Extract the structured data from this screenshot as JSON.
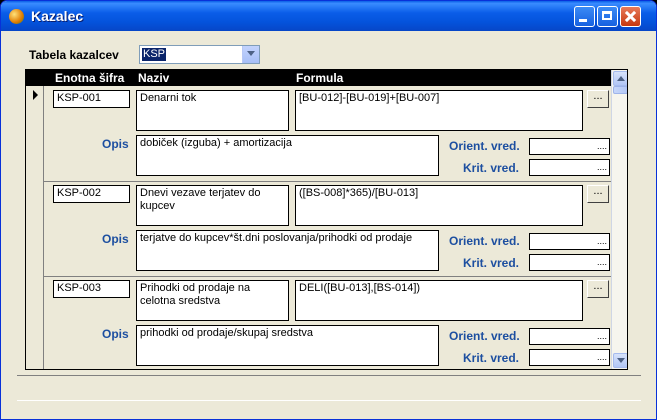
{
  "window": {
    "title": "Kazalec"
  },
  "filter": {
    "label": "Tabela kazalcev",
    "value": "KSP"
  },
  "columns": {
    "code": "Enotna šifra",
    "name": "Naziv",
    "formula": "Formula"
  },
  "labels": {
    "opis": "Opis",
    "orient": "Orient. vred.",
    "krit": "Krit. vred.",
    "dots": "...."
  },
  "builder_label": "...",
  "records": [
    {
      "code": "KSP-001",
      "name": "Denarni tok",
      "formula": "[BU-012]-[BU-019]+[BU-007]",
      "opis": "dobiček (izguba) + amortizacija",
      "selected": true
    },
    {
      "code": "KSP-002",
      "name": "Dnevi vezave terjatev do kupcev",
      "formula": "([BS-008]*365)/[BU-013]",
      "opis": "terjatve do kupcev*št.dni poslovanja/prihodki od prodaje",
      "selected": false
    },
    {
      "code": "KSP-003",
      "name": "Prihodki od prodaje na celotna sredstva",
      "formula": "DELI([BU-013],[BS-014])",
      "opis": "prihodki od prodaje/skupaj sredstva",
      "selected": false
    }
  ]
}
